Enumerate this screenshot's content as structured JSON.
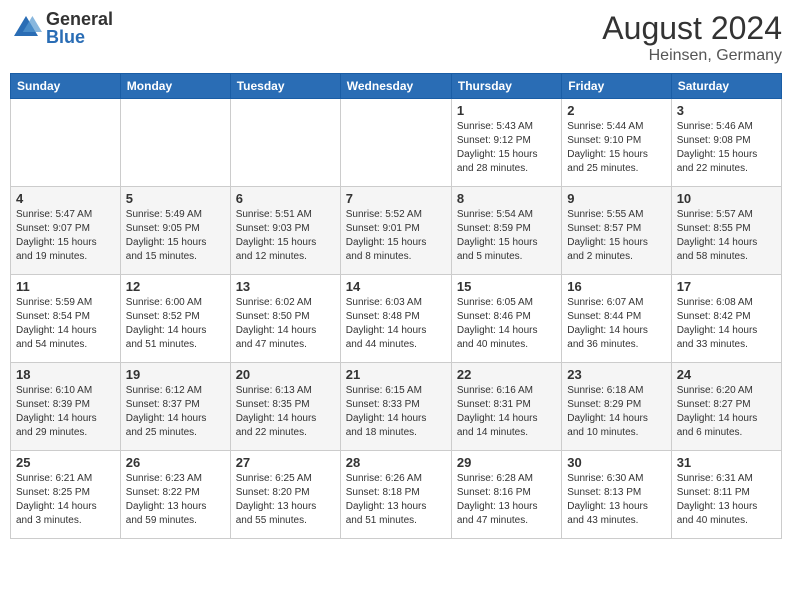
{
  "logo": {
    "general": "General",
    "blue": "Blue"
  },
  "title": "August 2024",
  "location": "Heinsen, Germany",
  "days_header": [
    "Sunday",
    "Monday",
    "Tuesday",
    "Wednesday",
    "Thursday",
    "Friday",
    "Saturday"
  ],
  "weeks": [
    [
      {
        "day": "",
        "info": ""
      },
      {
        "day": "",
        "info": ""
      },
      {
        "day": "",
        "info": ""
      },
      {
        "day": "",
        "info": ""
      },
      {
        "day": "1",
        "info": "Sunrise: 5:43 AM\nSunset: 9:12 PM\nDaylight: 15 hours\nand 28 minutes."
      },
      {
        "day": "2",
        "info": "Sunrise: 5:44 AM\nSunset: 9:10 PM\nDaylight: 15 hours\nand 25 minutes."
      },
      {
        "day": "3",
        "info": "Sunrise: 5:46 AM\nSunset: 9:08 PM\nDaylight: 15 hours\nand 22 minutes."
      }
    ],
    [
      {
        "day": "4",
        "info": "Sunrise: 5:47 AM\nSunset: 9:07 PM\nDaylight: 15 hours\nand 19 minutes."
      },
      {
        "day": "5",
        "info": "Sunrise: 5:49 AM\nSunset: 9:05 PM\nDaylight: 15 hours\nand 15 minutes."
      },
      {
        "day": "6",
        "info": "Sunrise: 5:51 AM\nSunset: 9:03 PM\nDaylight: 15 hours\nand 12 minutes."
      },
      {
        "day": "7",
        "info": "Sunrise: 5:52 AM\nSunset: 9:01 PM\nDaylight: 15 hours\nand 8 minutes."
      },
      {
        "day": "8",
        "info": "Sunrise: 5:54 AM\nSunset: 8:59 PM\nDaylight: 15 hours\nand 5 minutes."
      },
      {
        "day": "9",
        "info": "Sunrise: 5:55 AM\nSunset: 8:57 PM\nDaylight: 15 hours\nand 2 minutes."
      },
      {
        "day": "10",
        "info": "Sunrise: 5:57 AM\nSunset: 8:55 PM\nDaylight: 14 hours\nand 58 minutes."
      }
    ],
    [
      {
        "day": "11",
        "info": "Sunrise: 5:59 AM\nSunset: 8:54 PM\nDaylight: 14 hours\nand 54 minutes."
      },
      {
        "day": "12",
        "info": "Sunrise: 6:00 AM\nSunset: 8:52 PM\nDaylight: 14 hours\nand 51 minutes."
      },
      {
        "day": "13",
        "info": "Sunrise: 6:02 AM\nSunset: 8:50 PM\nDaylight: 14 hours\nand 47 minutes."
      },
      {
        "day": "14",
        "info": "Sunrise: 6:03 AM\nSunset: 8:48 PM\nDaylight: 14 hours\nand 44 minutes."
      },
      {
        "day": "15",
        "info": "Sunrise: 6:05 AM\nSunset: 8:46 PM\nDaylight: 14 hours\nand 40 minutes."
      },
      {
        "day": "16",
        "info": "Sunrise: 6:07 AM\nSunset: 8:44 PM\nDaylight: 14 hours\nand 36 minutes."
      },
      {
        "day": "17",
        "info": "Sunrise: 6:08 AM\nSunset: 8:42 PM\nDaylight: 14 hours\nand 33 minutes."
      }
    ],
    [
      {
        "day": "18",
        "info": "Sunrise: 6:10 AM\nSunset: 8:39 PM\nDaylight: 14 hours\nand 29 minutes."
      },
      {
        "day": "19",
        "info": "Sunrise: 6:12 AM\nSunset: 8:37 PM\nDaylight: 14 hours\nand 25 minutes."
      },
      {
        "day": "20",
        "info": "Sunrise: 6:13 AM\nSunset: 8:35 PM\nDaylight: 14 hours\nand 22 minutes."
      },
      {
        "day": "21",
        "info": "Sunrise: 6:15 AM\nSunset: 8:33 PM\nDaylight: 14 hours\nand 18 minutes."
      },
      {
        "day": "22",
        "info": "Sunrise: 6:16 AM\nSunset: 8:31 PM\nDaylight: 14 hours\nand 14 minutes."
      },
      {
        "day": "23",
        "info": "Sunrise: 6:18 AM\nSunset: 8:29 PM\nDaylight: 14 hours\nand 10 minutes."
      },
      {
        "day": "24",
        "info": "Sunrise: 6:20 AM\nSunset: 8:27 PM\nDaylight: 14 hours\nand 6 minutes."
      }
    ],
    [
      {
        "day": "25",
        "info": "Sunrise: 6:21 AM\nSunset: 8:25 PM\nDaylight: 14 hours\nand 3 minutes."
      },
      {
        "day": "26",
        "info": "Sunrise: 6:23 AM\nSunset: 8:22 PM\nDaylight: 13 hours\nand 59 minutes."
      },
      {
        "day": "27",
        "info": "Sunrise: 6:25 AM\nSunset: 8:20 PM\nDaylight: 13 hours\nand 55 minutes."
      },
      {
        "day": "28",
        "info": "Sunrise: 6:26 AM\nSunset: 8:18 PM\nDaylight: 13 hours\nand 51 minutes."
      },
      {
        "day": "29",
        "info": "Sunrise: 6:28 AM\nSunset: 8:16 PM\nDaylight: 13 hours\nand 47 minutes."
      },
      {
        "day": "30",
        "info": "Sunrise: 6:30 AM\nSunset: 8:13 PM\nDaylight: 13 hours\nand 43 minutes."
      },
      {
        "day": "31",
        "info": "Sunrise: 6:31 AM\nSunset: 8:11 PM\nDaylight: 13 hours\nand 40 minutes."
      }
    ]
  ]
}
